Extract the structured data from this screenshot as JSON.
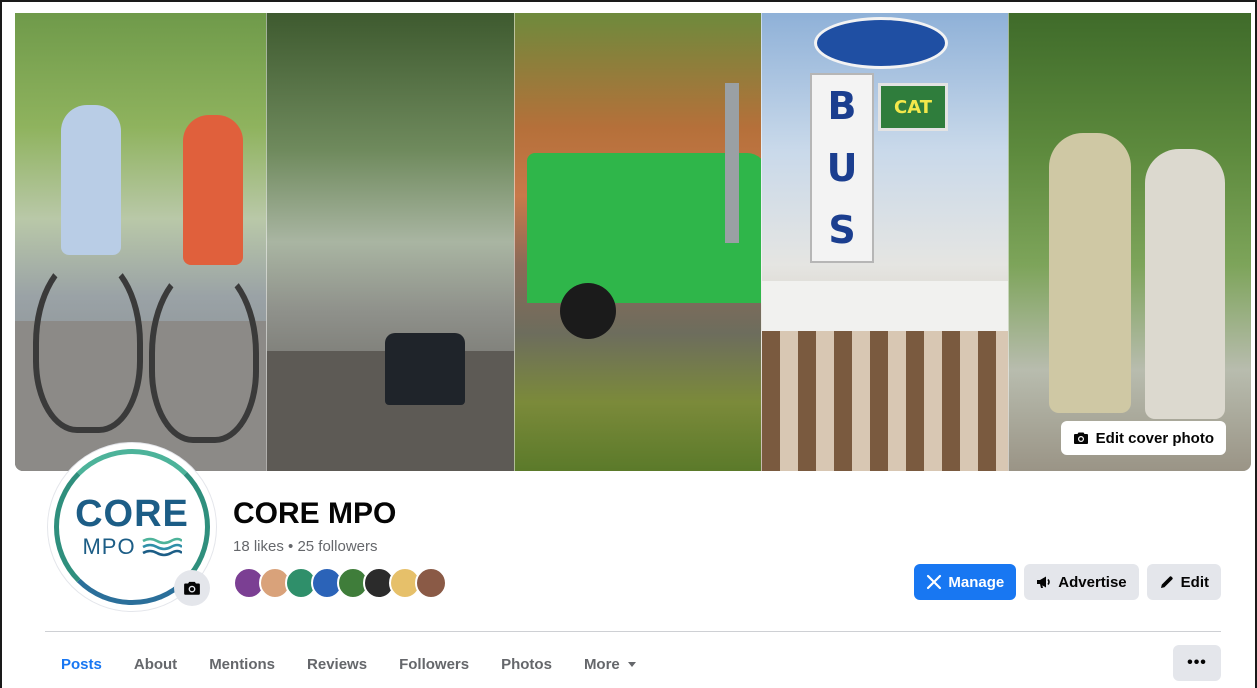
{
  "cover": {
    "panels": [
      "bike-riders-photo",
      "tree-lined-road-photo",
      "green-truck-photo",
      "bus-station-sign-photo",
      "elderly-couple-walking-photo"
    ],
    "sign_letters": [
      "B",
      "U",
      "S"
    ],
    "sign_badge": "CAT",
    "edit_label": "Edit cover photo"
  },
  "profile": {
    "logo_top": "CORE",
    "logo_bottom": "MPO",
    "logo_color": "#1c5d86",
    "ring_color": "#2f8f7d",
    "name": "CORE MPO",
    "stats": "18 likes • 25 followers",
    "friend_avatar_colors": [
      "#7b3f93",
      "#d9a27a",
      "#2f8f6a",
      "#2b63b8",
      "#3f7d3a",
      "#2b2b2b",
      "#e6c06a",
      "#8a5a46"
    ]
  },
  "actions": {
    "manage_label": "Manage",
    "advertise_label": "Advertise",
    "edit_label": "Edit"
  },
  "tabs": [
    {
      "label": "Posts",
      "active": true
    },
    {
      "label": "About",
      "active": false
    },
    {
      "label": "Mentions",
      "active": false
    },
    {
      "label": "Reviews",
      "active": false
    },
    {
      "label": "Followers",
      "active": false
    },
    {
      "label": "Photos",
      "active": false
    },
    {
      "label": "More",
      "active": false
    }
  ],
  "more_menu_label": "•••",
  "colors": {
    "accent": "#1877f2",
    "secondary_button": "#e4e6eb",
    "muted_text": "#65676b"
  }
}
